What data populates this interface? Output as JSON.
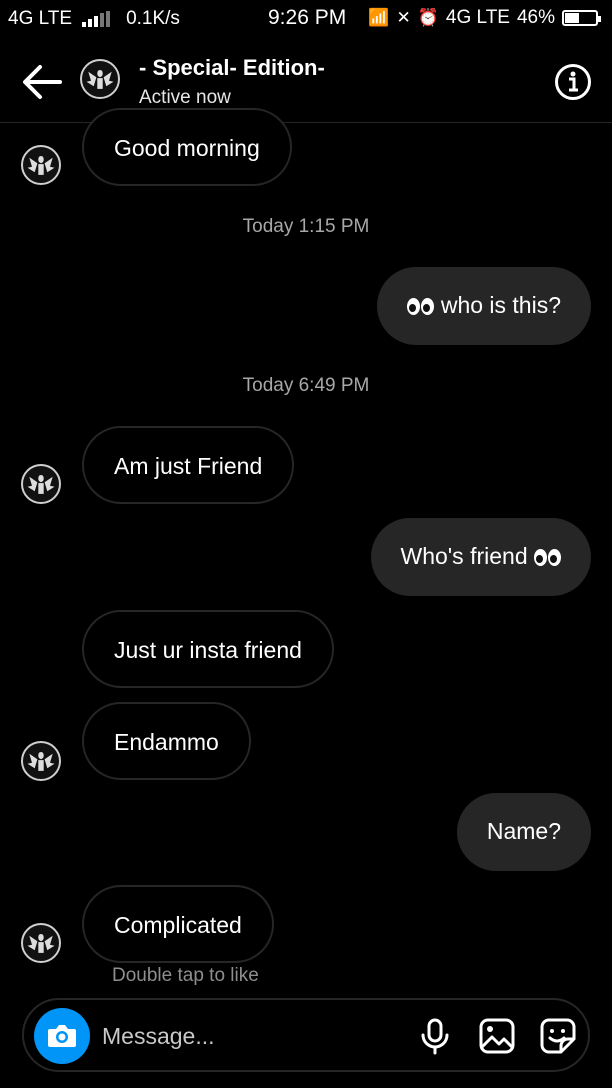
{
  "status_bar": {
    "network_left": "4G LTE",
    "data_speed": "0.1K/s",
    "time": "9:26 PM",
    "network_right": "4G LTE",
    "battery_percent": "46%",
    "battery_level": 0.46
  },
  "header": {
    "title": "- Special- Edition-",
    "subtitle": "Active now"
  },
  "messages": [
    {
      "direction": "in",
      "text": "Good morning",
      "avatar": true
    },
    {
      "type": "timestamp",
      "text": "Today 1:15 PM"
    },
    {
      "direction": "out",
      "emoji": "eyes",
      "text": "who is this?"
    },
    {
      "type": "timestamp",
      "text": "Today 6:49 PM"
    },
    {
      "direction": "in",
      "text": "Am just Friend",
      "avatar": true
    },
    {
      "direction": "out",
      "text": "Who's friend",
      "emoji": "eyes"
    },
    {
      "direction": "in",
      "text": "Just ur insta friend",
      "avatar": false
    },
    {
      "direction": "in",
      "text": "Endammo",
      "avatar": true
    },
    {
      "direction": "out",
      "text": "Name?"
    },
    {
      "direction": "in",
      "text": "Complicated",
      "avatar": true
    }
  ],
  "like_hint": "Double tap to like",
  "composer": {
    "placeholder": "Message...",
    "icons": [
      "camera-icon",
      "microphone-icon",
      "gallery-icon",
      "sticker-icon"
    ]
  },
  "colors": {
    "background": "#000000",
    "outgoing_bubble": "#262626",
    "incoming_border": "#262626",
    "camera_button": "#0095f6",
    "timestamp_text": "#a8a8a8"
  }
}
